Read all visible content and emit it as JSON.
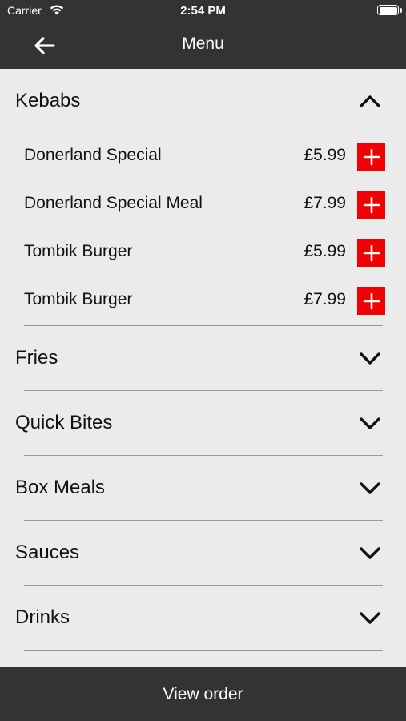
{
  "status_bar": {
    "carrier": "Carrier",
    "time": "2:54 PM"
  },
  "navbar": {
    "title": "Menu",
    "back_icon": "arrow-left-icon"
  },
  "sections": [
    {
      "title": "Kebabs",
      "expanded": true,
      "items": [
        {
          "name": "Donerland Special",
          "price": "£5.99"
        },
        {
          "name": "Donerland Special Meal",
          "price": "£7.99"
        },
        {
          "name": "Tombik Burger",
          "price": "£5.99"
        },
        {
          "name": "Tombik Burger",
          "price": "£7.99"
        }
      ]
    },
    {
      "title": "Fries",
      "expanded": false
    },
    {
      "title": "Quick Bites",
      "expanded": false
    },
    {
      "title": "Box Meals",
      "expanded": false
    },
    {
      "title": "Sauces",
      "expanded": false
    },
    {
      "title": "Drinks",
      "expanded": false
    }
  ],
  "footer": {
    "label": "View order"
  },
  "colors": {
    "bar": "#333333",
    "background": "#ebebeb",
    "add_button": "#f00000"
  }
}
